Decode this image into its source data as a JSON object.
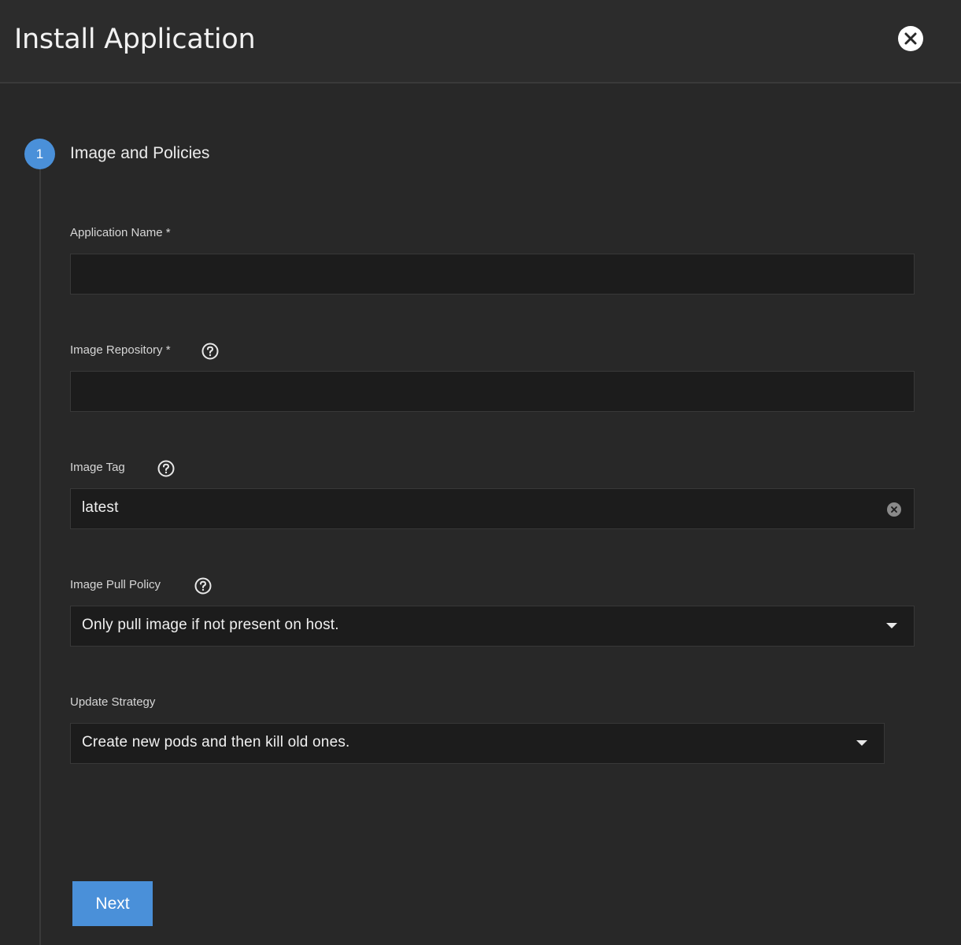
{
  "dialog": {
    "title": "Install Application",
    "close_icon": "close-icon"
  },
  "step": {
    "number": "1",
    "title": "Image and Policies"
  },
  "fields": {
    "app_name": {
      "label": "Application Name *",
      "value": ""
    },
    "image_repo": {
      "label": "Image Repository *",
      "value": "",
      "help_icon": "help-icon"
    },
    "image_tag": {
      "label": "Image Tag",
      "value": "latest",
      "help_icon": "help-icon",
      "clear_icon": "clear-icon"
    },
    "pull_policy": {
      "label": "Image Pull Policy",
      "value": "Only pull image if not present on host.",
      "help_icon": "help-icon"
    },
    "update_strategy": {
      "label": "Update Strategy",
      "value": "Create new pods and then kill old ones."
    }
  },
  "actions": {
    "next_label": "Next"
  },
  "colors": {
    "accent": "#4a90d9",
    "background": "#282828",
    "input_background": "#1c1c1c"
  }
}
